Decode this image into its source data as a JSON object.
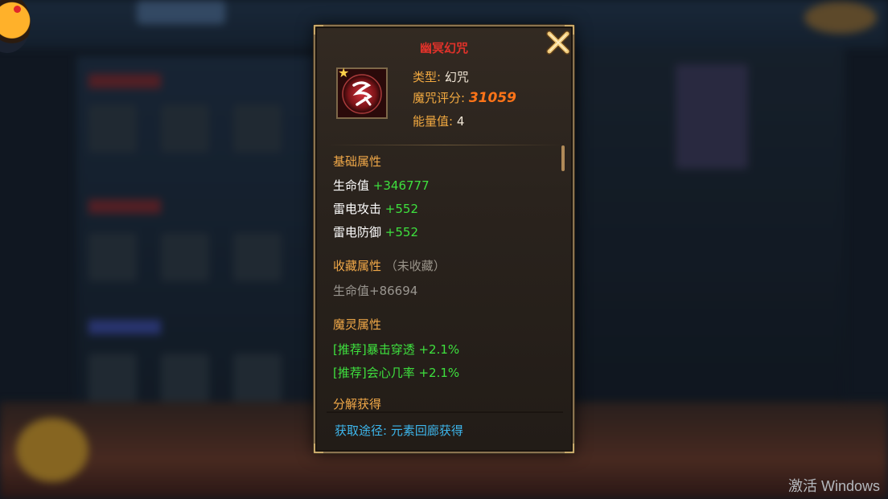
{
  "item": {
    "name": "幽冥幻咒",
    "type_label": "类型:",
    "type_value": "幻咒",
    "score_label": "魔咒评分:",
    "score_value": "31059",
    "energy_label": "能量值:",
    "energy_value": "4"
  },
  "sections": {
    "basic": {
      "title": "基础属性",
      "stats": [
        {
          "name": "生命值",
          "value": "+346777"
        },
        {
          "name": "雷电攻击",
          "value": "+552"
        },
        {
          "name": "雷电防御",
          "value": "+552"
        }
      ]
    },
    "collection": {
      "title": "收藏属性",
      "note": "（未收藏）",
      "stats": [
        {
          "text": "生命值+86694"
        }
      ]
    },
    "spirit": {
      "title": "魔灵属性",
      "stats": [
        {
          "text": "[推荐]暴击穿透 +2.1%"
        },
        {
          "text": "[推荐]会心几率 +2.1%"
        }
      ]
    },
    "decompose": {
      "title": "分解获得"
    }
  },
  "source": {
    "label": "获取途径:",
    "value": "元素回廊获得"
  },
  "watermark": "激活 Windows",
  "colors": {
    "title": "#e0322a",
    "section": "#f0a848",
    "green": "#3ee03e",
    "score": "#ff7418",
    "source": "#3db6ec"
  },
  "icons": {
    "close": "close-x-icon",
    "item": "curse-rune-icon",
    "rarity": "star-icon"
  }
}
